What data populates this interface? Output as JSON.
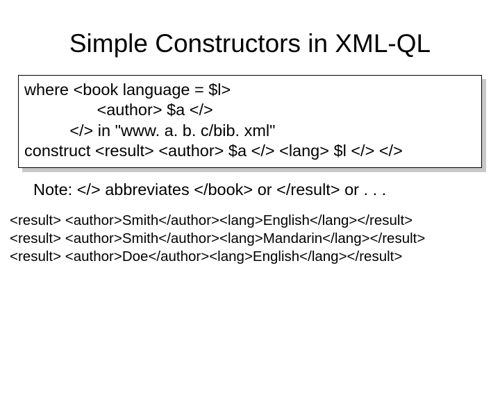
{
  "title": "Simple Constructors in XML-QL",
  "code": {
    "line1": "where <book language = $l>",
    "line2": "                <author> $a </>",
    "line3": "          </> in \"www. a. b. c/bib. xml\"",
    "line4": "construct <result> <author> $a </> <lang> $l </> </>"
  },
  "note": "Note: </> abbreviates </book> or </result> or . . .",
  "results": {
    "line1": "<result> <author>Smith</author><lang>English</lang></result>",
    "line2": "<result> <author>Smith</author><lang>Mandarin</lang></result>",
    "line3": "<result> <author>Doe</author><lang>English</lang></result>"
  }
}
